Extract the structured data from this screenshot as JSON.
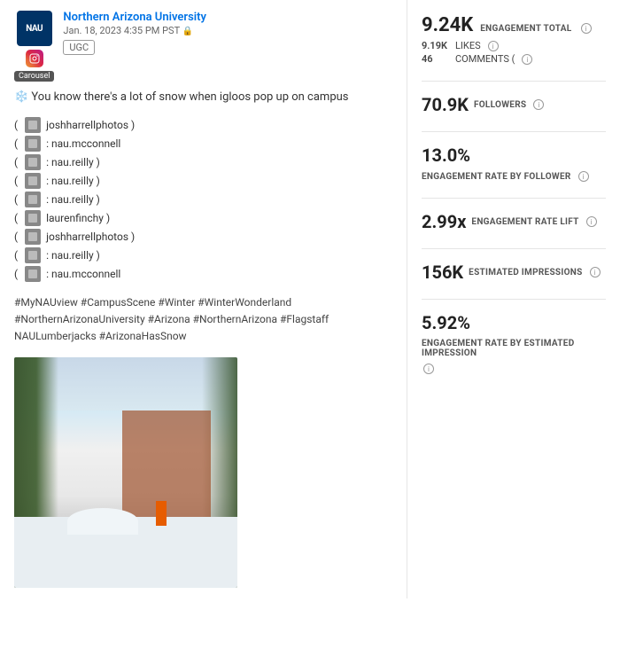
{
  "left": {
    "account": {
      "name": "Northern Arizona University",
      "date": "Jan. 18, 2023 4:35 PM PST",
      "ugc": "UGC",
      "platform": "Instagram",
      "type": "Carousel"
    },
    "caption": "❄️ You know there's a lot of snow when igloos pop up on campus",
    "tagged_users": [
      {
        "username": "joshharrellphotos",
        "suffix": " )"
      },
      {
        "username": "nau.mcconnell",
        "suffix": ""
      },
      {
        "username": "nau.reilly",
        "suffix": " )"
      },
      {
        "username": "nau.reilly",
        "suffix": " )"
      },
      {
        "username": "nau.reilly",
        "suffix": " )"
      },
      {
        "username": "laurenfinchy",
        "suffix": " )"
      },
      {
        "username": "joshharrellphotos",
        "suffix": " )"
      },
      {
        "username": "nau.reilly",
        "suffix": " )"
      },
      {
        "username": "nau.mcconnell",
        "suffix": ""
      }
    ],
    "hashtags": "#MyNAUview #CampusScene #Winter #WinterWonderland\n#NorthernArizonaUniversity #Arizona #NorthernArizona #Flagstaff\nNAULumberjacks #ArizonaHasSnow"
  },
  "right": {
    "engagement_total": {
      "label": "ENGAGEMENT TOTAL",
      "value": "9.24K",
      "sub": [
        {
          "num": "9.19K",
          "label": "LIKES"
        },
        {
          "num": "46",
          "label": "COMMENTS ("
        }
      ]
    },
    "followers": {
      "label": "FOLLOWERS",
      "value": "70.9K"
    },
    "engagement_rate_follower": {
      "label": "ENGAGEMENT RATE BY FOLLOWER",
      "value": "13.0%"
    },
    "engagement_rate_lift": {
      "label": "ENGAGEMENT RATE LIFT",
      "value": "2.99x"
    },
    "estimated_impressions": {
      "label": "ESTIMATED IMPRESSIONS",
      "value": "156K"
    },
    "engagement_rate_impression": {
      "label": "ENGAGEMENT RATE BY ESTIMATED IMPRESSION",
      "value": "5.92%"
    }
  },
  "icons": {
    "info": "i",
    "lock": "🔒"
  }
}
